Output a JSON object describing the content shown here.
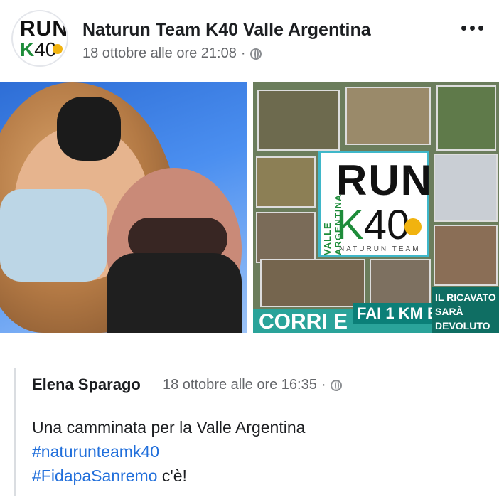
{
  "post": {
    "page_name": "Naturun Team K40 Valle Argentina",
    "timestamp": "18 ottobre alle ore 21:08",
    "separator": "·",
    "privacy_icon": "globe-icon",
    "more_icon": "more-options-icon",
    "avatar": {
      "logo_run": "RUN",
      "logo_k": "K",
      "logo_40": "40"
    }
  },
  "photos": {
    "photo2": {
      "logo_run": "RUN",
      "logo_k": "K",
      "logo_40": "40",
      "logo_vertical": "VALLE ARGENTINA",
      "logo_team": "NATURUN TEAM",
      "banner_left": "CORRI E",
      "banner_mid": "FAI 1 KM E",
      "banner_right": "IL RICAVATO SARÀ DEVOLUTO AGLI AMICI"
    }
  },
  "shared": {
    "author": "Elena Sparago",
    "timestamp": "18 ottobre alle ore 16:35",
    "separator": "·",
    "privacy_icon": "globe-icon",
    "text": "Una camminata per la Valle Argentina",
    "hashtag1": "#naturunteamk40",
    "hashtag2": "#FidapaSanremo",
    "text_suffix": " c'è!"
  },
  "colors": {
    "text": "#1c1e21",
    "secondary": "#65676b",
    "link": "#216fdb",
    "logo_green": "#1e8c3a",
    "logo_border": "#3fb7c9"
  }
}
